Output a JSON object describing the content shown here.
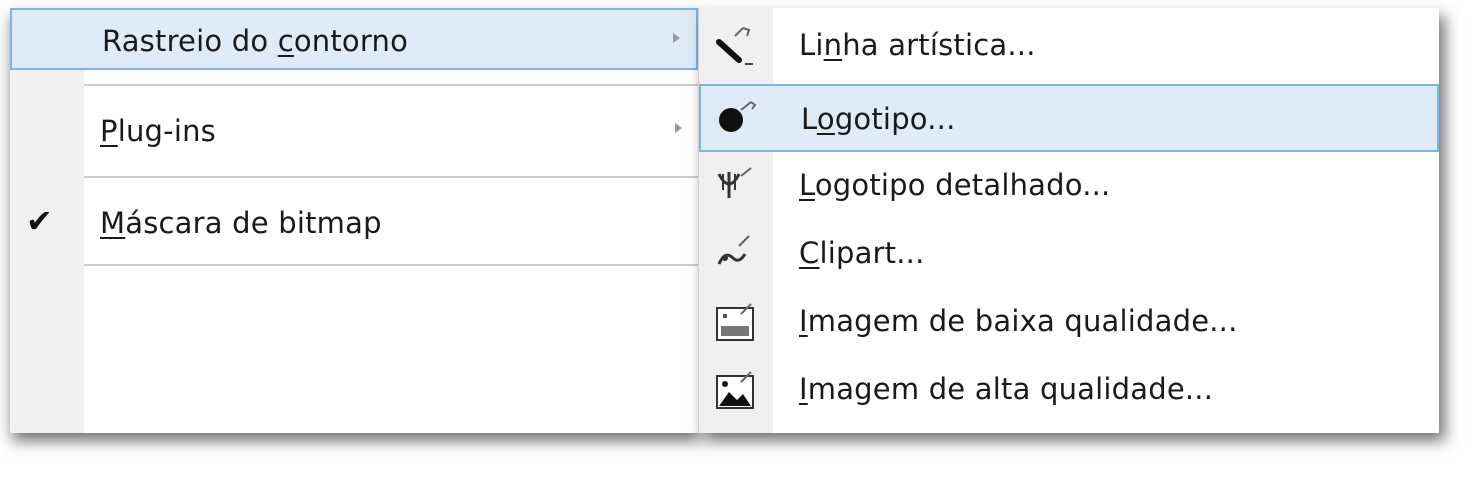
{
  "left_menu": {
    "items": [
      {
        "pre": "Rastreio do ",
        "acc": "c",
        "post": "ontorno",
        "submenu": true,
        "highlighted": true
      },
      {
        "pre": "",
        "acc": "P",
        "post": "lug-ins",
        "submenu": true
      },
      {
        "pre": "",
        "acc": "M",
        "post": "áscara de bitmap",
        "checked": true,
        "check_glyph": "✔"
      }
    ]
  },
  "right_menu": {
    "items": [
      {
        "pre": "Li",
        "acc": "n",
        "post": "ha artística...",
        "icon": "line-art-trace-icon"
      },
      {
        "pre": "L",
        "acc": "o",
        "post": "gotipo...",
        "icon": "logo-trace-icon",
        "highlighted": true
      },
      {
        "pre": "",
        "acc": "L",
        "post": "ogotipo detalhado...",
        "icon": "detailed-logo-trace-icon"
      },
      {
        "pre": "",
        "acc": "C",
        "post": "lipart...",
        "icon": "clipart-trace-icon"
      },
      {
        "pre": "",
        "acc": "I",
        "post": "magem de baixa qualidade...",
        "icon": "low-quality-image-trace-icon"
      },
      {
        "pre": "",
        "acc": "I",
        "post": "magem de alta qualidade...",
        "icon": "high-quality-image-trace-icon"
      }
    ]
  },
  "colors": {
    "highlight_bg": "#deecf9",
    "highlight_border": "#7fb4e2",
    "gutter": "#f0f0f0"
  }
}
